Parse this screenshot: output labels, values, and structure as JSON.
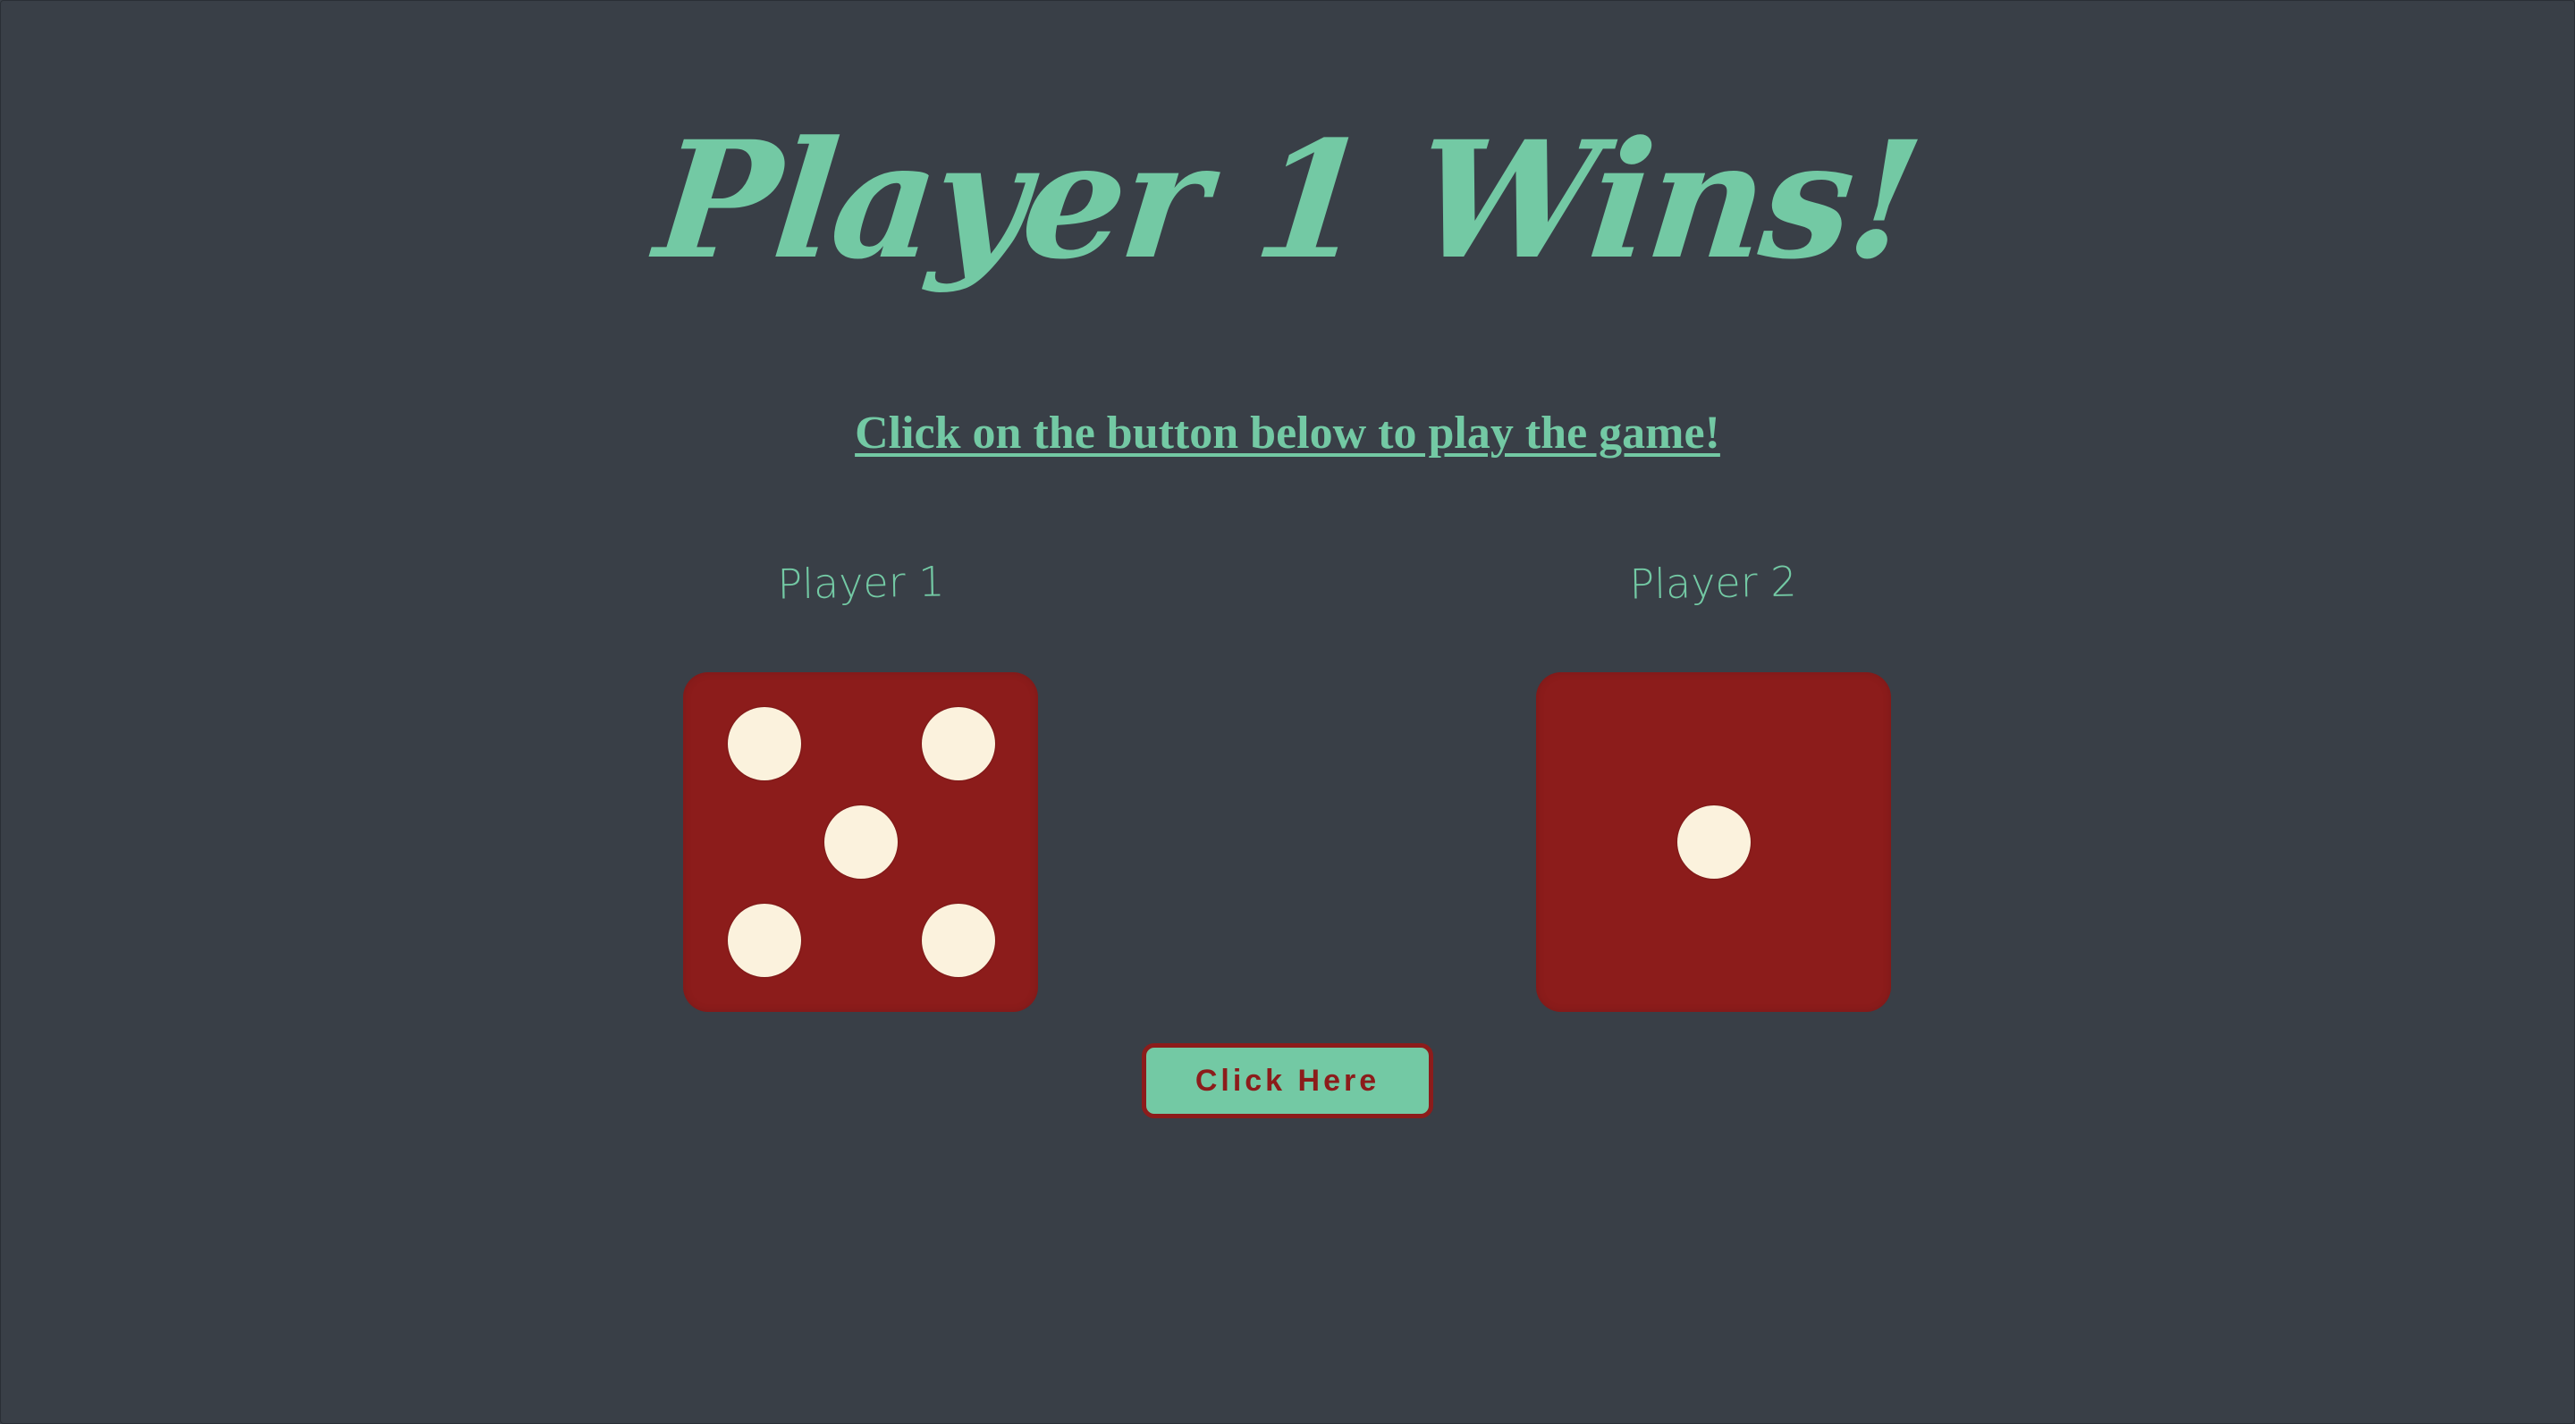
{
  "heading": {
    "title": "Player 1 Wins!",
    "subtitle": "Click on the button below to play the game!"
  },
  "players": [
    {
      "label": "Player 1",
      "die_value": 5
    },
    {
      "label": "Player 2",
      "die_value": 1
    }
  ],
  "action": {
    "button_label": "Click Here"
  },
  "colors": {
    "background": "#393f47",
    "accent": "#73c9a4",
    "die": "#8c1c1b",
    "pip": "#fbf2dd"
  }
}
